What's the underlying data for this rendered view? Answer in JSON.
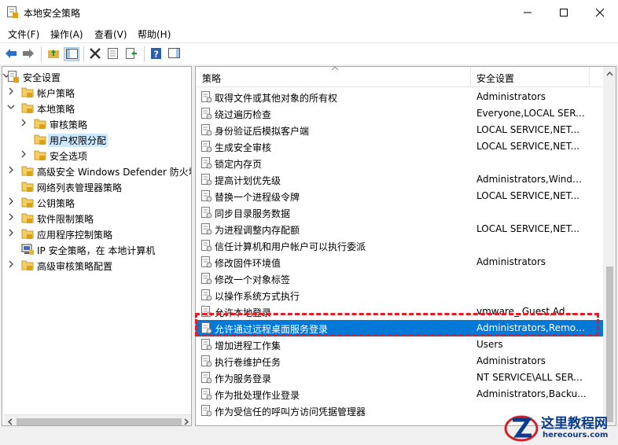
{
  "window": {
    "title": "本地安全策略"
  },
  "menu": [
    "文件(F)",
    "操作(A)",
    "查看(V)",
    "帮助(H)"
  ],
  "tree": [
    {
      "label": "安全设置",
      "expanded": true
    },
    {
      "label": "帐户策略"
    },
    {
      "label": "本地策略",
      "expanded": true
    },
    {
      "label": "审核策略"
    },
    {
      "label": "用户权限分配",
      "selected": true
    },
    {
      "label": "安全选项"
    },
    {
      "label": "高级安全 Windows Defender 防火墙"
    },
    {
      "label": "网络列表管理器策略"
    },
    {
      "label": "公钥策略"
    },
    {
      "label": "软件限制策略"
    },
    {
      "label": "应用程序控制策略"
    },
    {
      "label": "IP 安全策略，在 本地计算机"
    },
    {
      "label": "高级审核策略配置"
    }
  ],
  "list": {
    "columns": [
      "策略",
      "安全设置"
    ],
    "rows": [
      {
        "name": "取得文件或其他对象的所有权",
        "value": "Administrators"
      },
      {
        "name": "绕过遍历检查",
        "value": "Everyone,LOCAL SERV..."
      },
      {
        "name": "身份验证后模拟客户端",
        "value": "LOCAL SERVICE,NET..."
      },
      {
        "name": "生成安全审核",
        "value": "LOCAL SERVICE,NET..."
      },
      {
        "name": "锁定内存页",
        "value": ""
      },
      {
        "name": "提高计划优先级",
        "value": "Administrators,Windo..."
      },
      {
        "name": "替换一个进程级令牌",
        "value": "LOCAL SERVICE,NET..."
      },
      {
        "name": "同步目录服务数据",
        "value": ""
      },
      {
        "name": "为进程调整内存配额",
        "value": "LOCAL SERVICE,NET..."
      },
      {
        "name": "信任计算机和用户帐户可以执行委派",
        "value": ""
      },
      {
        "name": "修改固件环境值",
        "value": "Administrators"
      },
      {
        "name": "修改一个对象标签",
        "value": ""
      },
      {
        "name": "以操作系统方式执行",
        "value": ""
      },
      {
        "name": "允许本地登录",
        "value": "vmware_,Guest,Ad..."
      },
      {
        "name": "允许通过远程桌面服务登录",
        "value": "Administrators,Remot...",
        "selected": true
      },
      {
        "name": "增加进程工作集",
        "value": "Users"
      },
      {
        "name": "执行卷维护任务",
        "value": "Administrators"
      },
      {
        "name": "作为服务登录",
        "value": "NT SERVICE\\ALL SERV..."
      },
      {
        "name": "作为批处理作业登录",
        "value": "Administrators,Backu..."
      },
      {
        "name": "作为受信任的呼叫方访问凭据管理器",
        "value": ""
      }
    ]
  },
  "watermark": {
    "title": "这里教程网",
    "url": "herecours.com"
  }
}
